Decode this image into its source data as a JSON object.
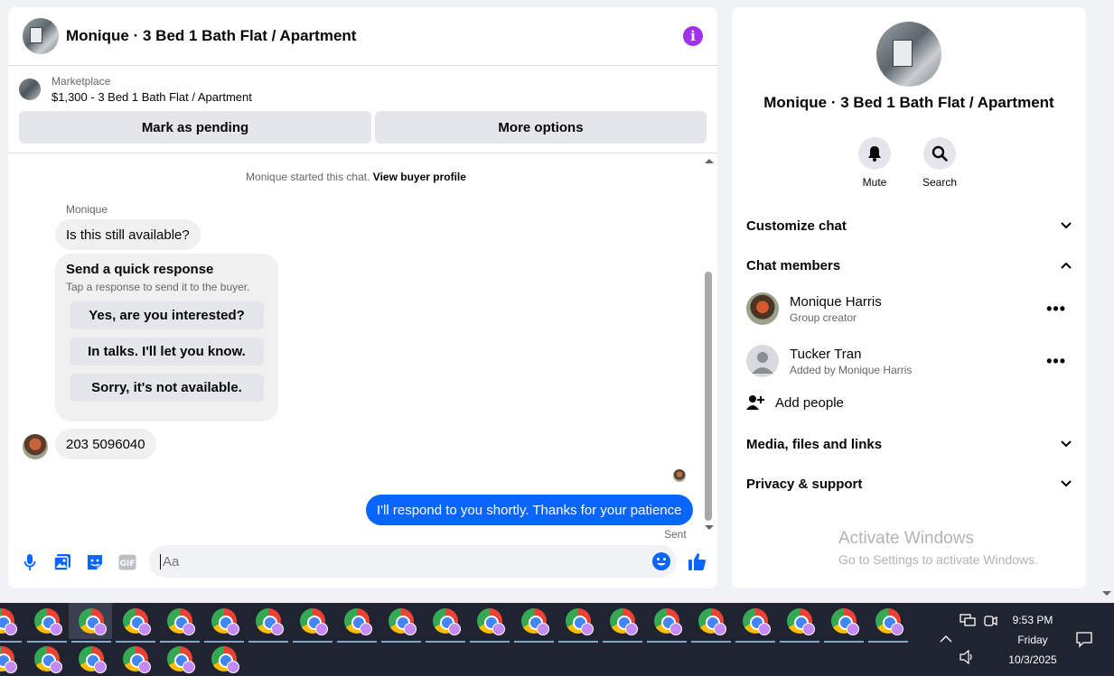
{
  "chat": {
    "title": "Monique · 3 Bed 1 Bath Flat / Apartment",
    "listing": {
      "category": "Marketplace",
      "price_title": "$1,300 - 3 Bed 1 Bath Flat / Apartment",
      "mark_pending_label": "Mark as pending",
      "more_options_label": "More options"
    },
    "system_message": "Monique started this chat.",
    "view_profile_label": "View buyer profile",
    "sender_name": "Monique",
    "messages": {
      "first": "Is this still available?",
      "phone": "203 5096040",
      "reply": "I'll respond to you shortly. Thanks for your patience",
      "sent_status": "Sent"
    },
    "quick_response": {
      "title": "Send a quick response",
      "subtitle": "Tap a response to send it to the buyer.",
      "options": [
        "Yes, are you interested?",
        "In talks. I'll let you know.",
        "Sorry, it's not available."
      ]
    },
    "composer": {
      "placeholder": "Aa"
    }
  },
  "info": {
    "title": "Monique · 3 Bed 1 Bath Flat / Apartment",
    "actions": {
      "mute": "Mute",
      "search": "Search"
    },
    "sections": {
      "customize": "Customize chat",
      "members": "Chat members",
      "media": "Media, files and links",
      "privacy": "Privacy & support"
    },
    "members": [
      {
        "name": "Monique Harris",
        "role": "Group creator"
      },
      {
        "name": "Tucker Tran",
        "role": "Added by Monique Harris"
      }
    ],
    "add_people": "Add people"
  },
  "watermark": {
    "line1": "Activate Windows",
    "line2": "Go to Settings to activate Windows."
  },
  "taskbar": {
    "time": "9:53 PM",
    "day": "Friday",
    "date": "10/3/2025"
  },
  "colors": {
    "accent_blue": "#0866ff",
    "info_purple": "#a033e8",
    "taskbar": "#1f2430"
  }
}
